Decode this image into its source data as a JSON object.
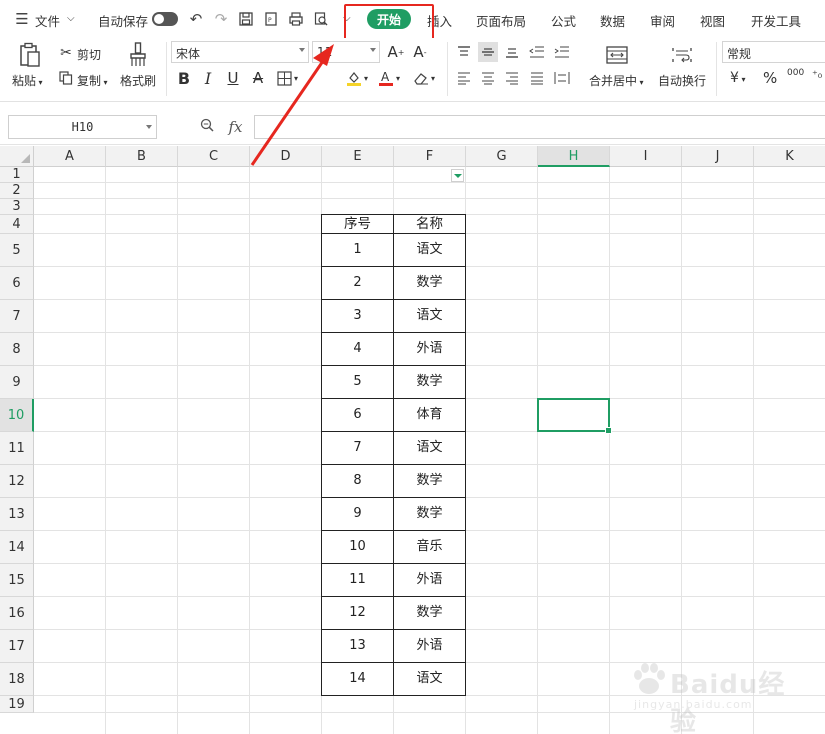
{
  "menu": {
    "file_label": "文件",
    "autosave_label": "自动保存",
    "tabs": [
      "开始",
      "插入",
      "页面布局",
      "公式",
      "数据",
      "审阅",
      "视图",
      "开发工具"
    ],
    "active_tab": "开始",
    "accent_color": "#1f9d63",
    "annotation_color": "#e6271f"
  },
  "ribbon": {
    "paste_label": "粘贴",
    "cut_label": "剪切",
    "copy_label": "复制",
    "format_painter_label": "格式刷",
    "font_name": "宋体",
    "font_size": "11",
    "merge_center_label": "合并居中",
    "wrap_text_label": "自动换行",
    "number_format": "常规",
    "currency_symbol": "¥",
    "percent_symbol": "%",
    "thousands_symbol": "000"
  },
  "formula_bar": {
    "cell_ref": "H10",
    "fx_label": "fx",
    "value": ""
  },
  "sheet": {
    "columns": [
      "A",
      "B",
      "C",
      "D",
      "E",
      "F",
      "G",
      "H",
      "I",
      "J",
      "K"
    ],
    "active_column": "H",
    "rows": [
      "1",
      "2",
      "3",
      "4",
      "5",
      "6",
      "7",
      "8",
      "9",
      "10",
      "11",
      "12",
      "13",
      "14",
      "15",
      "16",
      "17",
      "18",
      "19"
    ],
    "active_row": "10",
    "table_header": [
      "序号",
      "名称"
    ],
    "table_rows": [
      [
        "1",
        "语文"
      ],
      [
        "2",
        "数学"
      ],
      [
        "3",
        "语文"
      ],
      [
        "4",
        "外语"
      ],
      [
        "5",
        "数学"
      ],
      [
        "6",
        "体育"
      ],
      [
        "7",
        "语文"
      ],
      [
        "8",
        "数学"
      ],
      [
        "9",
        "数学"
      ],
      [
        "10",
        "音乐"
      ],
      [
        "11",
        "外语"
      ],
      [
        "12",
        "数学"
      ],
      [
        "13",
        "外语"
      ],
      [
        "14",
        "语文"
      ]
    ]
  },
  "watermark": {
    "brand": "Baidu经验",
    "url": "jingyan.baidu.com"
  }
}
